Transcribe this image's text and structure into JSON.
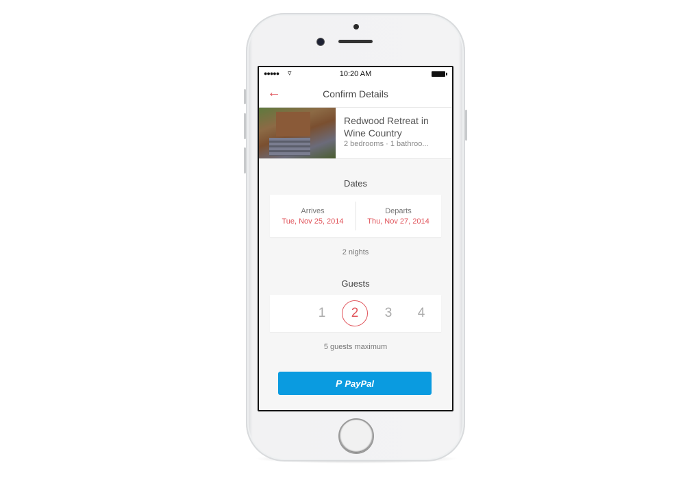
{
  "status_bar": {
    "signal": "●●●●●",
    "wifi_icon": "wifi-icon",
    "time": "10:20 AM",
    "battery_icon": "battery-icon"
  },
  "nav": {
    "back_icon": "←",
    "title": "Confirm Details"
  },
  "listing": {
    "title": "Redwood Retreat in Wine Country",
    "subtitle": "2 bedrooms · 1 bathroo..."
  },
  "dates": {
    "heading": "Dates",
    "arrives_label": "Arrives",
    "arrives_value": "Tue, Nov 25, 2014",
    "departs_label": "Departs",
    "departs_value": "Thu, Nov 27, 2014",
    "nights": "2 nights"
  },
  "guests": {
    "heading": "Guests",
    "options": [
      "1",
      "2",
      "3",
      "4"
    ],
    "selected": "2",
    "max_caption": "5 guests maximum"
  },
  "payment": {
    "logo": "P",
    "label": "PayPal"
  },
  "colors": {
    "accent": "#e0535a",
    "paypal_blue": "#0a9be0"
  }
}
